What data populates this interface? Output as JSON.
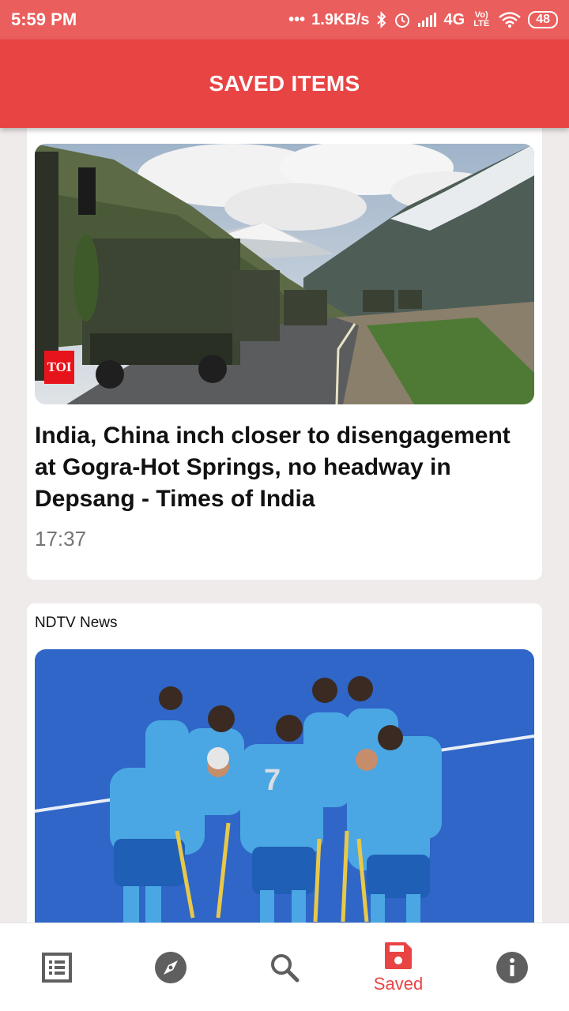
{
  "status_bar": {
    "time": "5:59 PM",
    "network_speed": "1.9KB/s",
    "signal": "4G",
    "volte": "Vo) LTE",
    "battery": "48"
  },
  "app_bar": {
    "title": "SAVED ITEMS"
  },
  "articles": [
    {
      "source_badge": "TOI",
      "headline": "India, China inch closer to disengagement at Gogra-Hot Springs, no headway in Depsang - Times of India",
      "time": "17:37"
    },
    {
      "source": "NDTV News"
    }
  ],
  "bottom_nav": {
    "items": [
      {
        "icon": "list-icon"
      },
      {
        "icon": "compass-icon"
      },
      {
        "icon": "search-icon"
      },
      {
        "icon": "save-icon",
        "label": "Saved",
        "active": true
      },
      {
        "icon": "info-icon"
      }
    ]
  },
  "colors": {
    "status_bar": "#ea5e5d",
    "app_bar": "#e94444",
    "accent": "#e94444",
    "background": "#efebea",
    "nav_icon": "#5f5f5f"
  }
}
